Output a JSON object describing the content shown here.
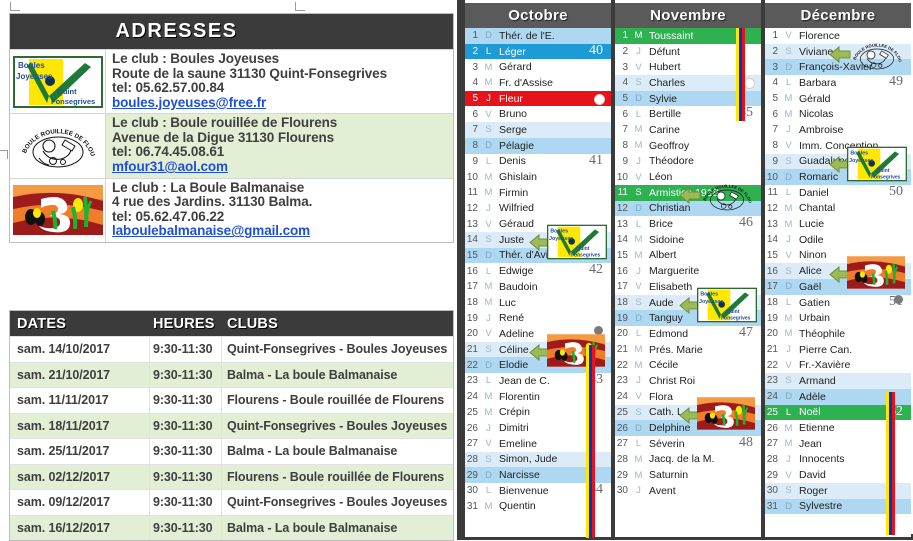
{
  "addresses": {
    "title": "ADRESSES",
    "rows": [
      {
        "logo": "boules-joyeuses-logo",
        "lines": [
          "Le club : Boules Joyeuses",
          "Route de la saune 31130 Quint-Fonsegrives",
          "tel: 05.62.57.00.84"
        ],
        "email": "boules.joyeuses@free.fr"
      },
      {
        "logo": "boule-rouillee-flourens-logo",
        "lines": [
          "Le club : Boule rouillée de Flourens",
          "Avenue de la Digue 31130 Flourens",
          "tel: 06.74.45.08.61"
        ],
        "email": "mfour31@aol.com"
      },
      {
        "logo": "boule-balmanaise-logo",
        "lines": [
          "Le club : La Boule Balmanaise",
          "4 rue des Jardins. 31130 Balma.",
          "tel: 05.62.47.06.22"
        ],
        "email": "laboulebalmanaise@gmail.com"
      }
    ]
  },
  "schedule": {
    "headers": {
      "date": "DATES",
      "hours": "HEURES",
      "clubs": "CLUBS"
    },
    "rows": [
      {
        "date": "sam.  14/10/2017",
        "hours": "9:30-11:30",
        "club": "Quint-Fonsegrives - Boules Joyeuses"
      },
      {
        "date": "sam.  21/10/2017",
        "hours": "9:30-11:30",
        "club": "Balma - La boule Balmanaise"
      },
      {
        "date": "sam.  11/11/2017",
        "hours": "9:30-11:30",
        "club": "Flourens - Boule rouillée de Flourens"
      },
      {
        "date": "sam.  18/11/2017",
        "hours": "9:30-11:30",
        "club": "Quint-Fonsegrives - Boules Joyeuses"
      },
      {
        "date": "sam.  25/11/2017",
        "hours": "9:30-11:30",
        "club": "Balma - La boule Balmanaise"
      },
      {
        "date": "sam.  02/12/2017",
        "hours": "9:30-11:30",
        "club": "Flourens - Boule rouillée de Flourens"
      },
      {
        "date": "sam.  09/12/2017",
        "hours": "9:30-11:30",
        "club": "Quint-Fonsegrives - Boules Joyeuses"
      },
      {
        "date": "sam.  16/12/2017",
        "hours": "9:30-11:30",
        "club": "Balma - La boule Balmanaise"
      }
    ]
  },
  "calendar": {
    "months": [
      {
        "name": "Octobre",
        "days": [
          {
            "n": "1",
            "dow": "D",
            "name": "Thér. de l'E.",
            "style": "sun"
          },
          {
            "n": "2",
            "dow": "L",
            "name": "Léger",
            "style": "mon-hl",
            "week": "40"
          },
          {
            "n": "3",
            "dow": "M",
            "name": "Gérard",
            "style": ""
          },
          {
            "n": "4",
            "dow": "M",
            "name": "Fr. d'Assise",
            "style": ""
          },
          {
            "n": "5",
            "dow": "J",
            "name": "Fleur",
            "style": "red",
            "moon": "new"
          },
          {
            "n": "6",
            "dow": "V",
            "name": "Bruno",
            "style": ""
          },
          {
            "n": "7",
            "dow": "S",
            "name": "Serge",
            "style": "sat"
          },
          {
            "n": "8",
            "dow": "D",
            "name": "Pélagie",
            "style": "sun"
          },
          {
            "n": "9",
            "dow": "L",
            "name": "Denis",
            "style": "",
            "week": "41"
          },
          {
            "n": "10",
            "dow": "M",
            "name": "Ghislain",
            "style": ""
          },
          {
            "n": "11",
            "dow": "M",
            "name": "Firmin",
            "style": ""
          },
          {
            "n": "12",
            "dow": "J",
            "name": "Wilfried",
            "style": ""
          },
          {
            "n": "13",
            "dow": "V",
            "name": "Géraud",
            "style": ""
          },
          {
            "n": "14",
            "dow": "S",
            "name": "Juste",
            "style": "sat",
            "marker": "boules-joyeuses"
          },
          {
            "n": "15",
            "dow": "D",
            "name": "Thér. d'Avila",
            "style": "sun"
          },
          {
            "n": "16",
            "dow": "L",
            "name": "Edwige",
            "style": "",
            "week": "42"
          },
          {
            "n": "17",
            "dow": "M",
            "name": "Baudoin",
            "style": ""
          },
          {
            "n": "18",
            "dow": "M",
            "name": "Luc",
            "style": ""
          },
          {
            "n": "19",
            "dow": "J",
            "name": "René",
            "style": ""
          },
          {
            "n": "20",
            "dow": "V",
            "name": "Adeline",
            "style": "",
            "moon": "full"
          },
          {
            "n": "21",
            "dow": "S",
            "name": "Céline",
            "style": "sat",
            "marker": "boule-balmanaise"
          },
          {
            "n": "22",
            "dow": "D",
            "name": "Elodie",
            "style": "sun"
          },
          {
            "n": "23",
            "dow": "L",
            "name": "Jean de C.",
            "style": "",
            "week": "43"
          },
          {
            "n": "24",
            "dow": "M",
            "name": "Florentin",
            "style": ""
          },
          {
            "n": "25",
            "dow": "M",
            "name": "Crépin",
            "style": ""
          },
          {
            "n": "26",
            "dow": "J",
            "name": "Dimitri",
            "style": ""
          },
          {
            "n": "27",
            "dow": "V",
            "name": "Emeline",
            "style": ""
          },
          {
            "n": "28",
            "dow": "S",
            "name": "Simon, Jude",
            "style": "sat"
          },
          {
            "n": "29",
            "dow": "D",
            "name": "Narcisse",
            "style": "sun"
          },
          {
            "n": "30",
            "dow": "L",
            "name": "Bienvenue",
            "style": "",
            "week": "44"
          },
          {
            "n": "31",
            "dow": "M",
            "name": "Quentin",
            "style": ""
          }
        ]
      },
      {
        "name": "Novembre",
        "days": [
          {
            "n": "1",
            "dow": "M",
            "name": "Toussaint",
            "style": "green"
          },
          {
            "n": "2",
            "dow": "J",
            "name": "Défunt",
            "style": ""
          },
          {
            "n": "3",
            "dow": "V",
            "name": "Hubert",
            "style": ""
          },
          {
            "n": "4",
            "dow": "S",
            "name": "Charles",
            "style": "sat",
            "moon": "new"
          },
          {
            "n": "5",
            "dow": "D",
            "name": "Sylvie",
            "style": "sun"
          },
          {
            "n": "6",
            "dow": "L",
            "name": "Bertille",
            "style": "",
            "week": "45"
          },
          {
            "n": "7",
            "dow": "M",
            "name": "Carine",
            "style": ""
          },
          {
            "n": "8",
            "dow": "M",
            "name": "Geoffroy",
            "style": ""
          },
          {
            "n": "9",
            "dow": "J",
            "name": "Théodore",
            "style": ""
          },
          {
            "n": "10",
            "dow": "V",
            "name": "Léon",
            "style": ""
          },
          {
            "n": "11",
            "dow": "S",
            "name": "Armistice 1918",
            "style": "green",
            "marker": "boule-rouillee"
          },
          {
            "n": "12",
            "dow": "D",
            "name": "Christian",
            "style": "sun"
          },
          {
            "n": "13",
            "dow": "L",
            "name": "Brice",
            "style": "",
            "week": "46"
          },
          {
            "n": "14",
            "dow": "M",
            "name": "Sidoine",
            "style": ""
          },
          {
            "n": "15",
            "dow": "M",
            "name": "Albert",
            "style": ""
          },
          {
            "n": "16",
            "dow": "J",
            "name": "Marguerite",
            "style": ""
          },
          {
            "n": "17",
            "dow": "V",
            "name": "Elisabeth",
            "style": ""
          },
          {
            "n": "18",
            "dow": "S",
            "name": "Aude",
            "style": "sat",
            "marker": "boules-joyeuses"
          },
          {
            "n": "19",
            "dow": "D",
            "name": "Tanguy",
            "style": "sun"
          },
          {
            "n": "20",
            "dow": "L",
            "name": "Edmond",
            "style": "",
            "week": "47"
          },
          {
            "n": "21",
            "dow": "M",
            "name": "Prés. Marie",
            "style": ""
          },
          {
            "n": "22",
            "dow": "M",
            "name": "Cécile",
            "style": ""
          },
          {
            "n": "23",
            "dow": "J",
            "name": "Christ Roi",
            "style": ""
          },
          {
            "n": "24",
            "dow": "V",
            "name": "Flora",
            "style": ""
          },
          {
            "n": "25",
            "dow": "S",
            "name": "Cath. L.",
            "style": "sat",
            "marker": "boule-balmanaise"
          },
          {
            "n": "26",
            "dow": "D",
            "name": "Delphine",
            "style": "sun"
          },
          {
            "n": "27",
            "dow": "L",
            "name": "Séverin",
            "style": "",
            "week": "48"
          },
          {
            "n": "28",
            "dow": "M",
            "name": "Jacq. de la M.",
            "style": ""
          },
          {
            "n": "29",
            "dow": "M",
            "name": "Saturnin",
            "style": ""
          },
          {
            "n": "30",
            "dow": "J",
            "name": "Avent",
            "style": ""
          }
        ]
      },
      {
        "name": "Décembre",
        "days": [
          {
            "n": "1",
            "dow": "V",
            "name": "Florence",
            "style": ""
          },
          {
            "n": "2",
            "dow": "S",
            "name": "Viviane",
            "style": "sat",
            "marker": "boule-rouillee"
          },
          {
            "n": "3",
            "dow": "D",
            "name": "François-Xavier",
            "style": "sun"
          },
          {
            "n": "4",
            "dow": "L",
            "name": "Barbara",
            "style": "",
            "week": "49"
          },
          {
            "n": "5",
            "dow": "M",
            "name": "Gérald",
            "style": ""
          },
          {
            "n": "6",
            "dow": "M",
            "name": "Nicolas",
            "style": ""
          },
          {
            "n": "7",
            "dow": "J",
            "name": "Ambroise",
            "style": ""
          },
          {
            "n": "8",
            "dow": "V",
            "name": "Imm. Conception",
            "style": ""
          },
          {
            "n": "9",
            "dow": "S",
            "name": "Guadalupe",
            "style": "sat",
            "marker": "boules-joyeuses"
          },
          {
            "n": "10",
            "dow": "D",
            "name": "Romaric",
            "style": "sun"
          },
          {
            "n": "11",
            "dow": "L",
            "name": "Daniel",
            "style": "",
            "week": "50"
          },
          {
            "n": "12",
            "dow": "M",
            "name": "Chantal",
            "style": ""
          },
          {
            "n": "13",
            "dow": "M",
            "name": "Lucie",
            "style": ""
          },
          {
            "n": "14",
            "dow": "J",
            "name": "Odile",
            "style": ""
          },
          {
            "n": "15",
            "dow": "V",
            "name": "Ninon",
            "style": ""
          },
          {
            "n": "16",
            "dow": "S",
            "name": "Alice",
            "style": "sat",
            "marker": "boule-balmanaise"
          },
          {
            "n": "17",
            "dow": "D",
            "name": "Gaël",
            "style": "sun"
          },
          {
            "n": "18",
            "dow": "L",
            "name": "Gatien",
            "style": "",
            "week": "51",
            "moon": "full"
          },
          {
            "n": "19",
            "dow": "M",
            "name": "Urbain",
            "style": ""
          },
          {
            "n": "20",
            "dow": "M",
            "name": "Théophile",
            "style": ""
          },
          {
            "n": "21",
            "dow": "J",
            "name": "Pierre Can.",
            "style": ""
          },
          {
            "n": "22",
            "dow": "V",
            "name": "Fr.-Xavière",
            "style": ""
          },
          {
            "n": "23",
            "dow": "S",
            "name": "Armand",
            "style": "sat"
          },
          {
            "n": "24",
            "dow": "D",
            "name": "Adèle",
            "style": "sun"
          },
          {
            "n": "25",
            "dow": "L",
            "name": "Noël",
            "style": "green",
            "week": "52"
          },
          {
            "n": "26",
            "dow": "M",
            "name": "Etienne",
            "style": ""
          },
          {
            "n": "27",
            "dow": "M",
            "name": "Jean",
            "style": ""
          },
          {
            "n": "28",
            "dow": "J",
            "name": "Innocents",
            "style": ""
          },
          {
            "n": "29",
            "dow": "V",
            "name": "David",
            "style": ""
          },
          {
            "n": "30",
            "dow": "S",
            "name": "Roger",
            "style": "sat"
          },
          {
            "n": "31",
            "dow": "D",
            "name": "Sylvestre",
            "style": "sun"
          }
        ]
      }
    ]
  },
  "colors": {
    "header_dark": "#3b3b3b",
    "month_header": "#5a5a5a",
    "alt_green": "#e2efd4",
    "saturday": "#dbecf8",
    "sunday": "#aed8f2",
    "monday_highlight": "#1e9ad6",
    "holiday_green": "#2eb150",
    "red_day": "#e8121b",
    "link_blue": "#1f4fd8",
    "flag_yellow": "#ffe800",
    "flag_blue": "#0034c8",
    "flag_red": "#e8121b"
  }
}
